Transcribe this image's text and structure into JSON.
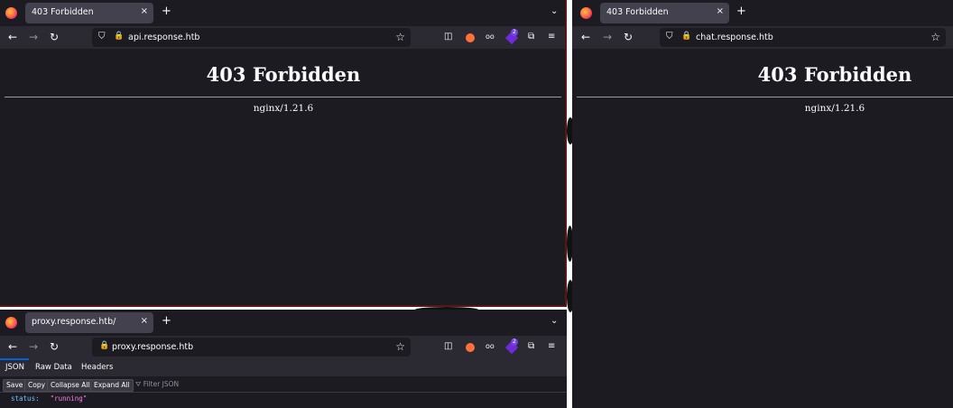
{
  "windows": [
    {
      "tab_title": "403 Forbidden",
      "url": "api.response.htb",
      "heading": "403 Forbidden",
      "server": "nginx/1.21.6",
      "extension_badge": "2"
    },
    {
      "tab_title": "403 Forbidden",
      "url": "chat.response.htb",
      "heading": "403 Forbidden",
      "server": "nginx/1.21.6"
    },
    {
      "tab_title": "proxy.response.htb/",
      "url": "proxy.response.htb",
      "extension_badge": "2",
      "json_viewer": {
        "tabs": [
          "JSON",
          "Raw Data",
          "Headers"
        ],
        "toolbar": [
          "Save",
          "Copy",
          "Collapse All",
          "Expand All"
        ],
        "filter_placeholder": "Filter JSON",
        "key": "status:",
        "value": "\"running\""
      }
    }
  ],
  "icons": {
    "close": "×",
    "new_tab": "+",
    "list_all_tabs": "⌄",
    "back": "←",
    "forward": "→",
    "reload": "↻",
    "shield": "⛉",
    "lock": "🔒",
    "bookmark_star": "☆",
    "pocket": "◫",
    "extensions": "⧉",
    "menu": "≡",
    "filter": "⛛"
  },
  "colors": {
    "page_bg": "#1c1b22",
    "toolbar_bg": "#2b2a33",
    "tab_selected": "#42414d",
    "accent": "#0060df",
    "json_key": "#75bfff",
    "json_string": "#ff7de9"
  }
}
